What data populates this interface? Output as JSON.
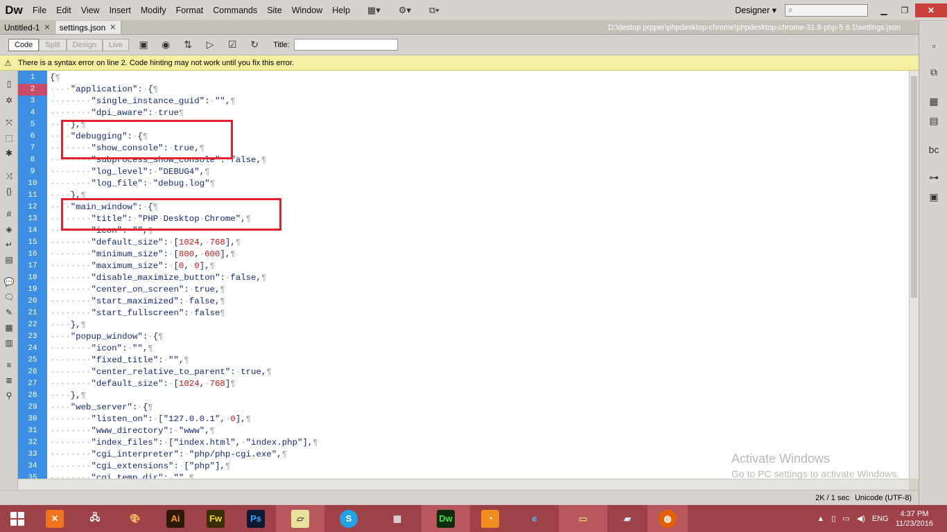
{
  "app": {
    "logo": "Dw",
    "menus": [
      "File",
      "Edit",
      "View",
      "Insert",
      "Modify",
      "Format",
      "Commands",
      "Site",
      "Window",
      "Help"
    ],
    "workspace": "Designer",
    "workspace_chevron": "▾"
  },
  "tabs": [
    {
      "label": "Untitled-1",
      "active": false
    },
    {
      "label": "settings.json",
      "active": true
    }
  ],
  "filepath": "D:\\destop prpper\\phpdesktop-chrome\\phpdesktop-chrome-31.8-php-5.6.1\\settings.json",
  "toolbar": {
    "views": [
      "Code",
      "Split",
      "Design",
      "Live"
    ],
    "title_label": "Title:",
    "title_value": ""
  },
  "warning": "There is a syntax error on line 2.  Code hinting may not work until you fix this error.",
  "editor": {
    "error_line": 2,
    "lines": [
      "{¶",
      "····\"application\":·{¶",
      "········\"single_instance_guid\":·\"\",¶",
      "········\"dpi_aware\":·true¶",
      "····},¶",
      "····\"debugging\":·{¶",
      "········\"show_console\":·true,¶",
      "········\"subprocess_show_console\":·false,¶",
      "········\"log_level\":·\"DEBUG4\",¶",
      "········\"log_file\":·\"debug.log\"¶",
      "····},¶",
      "····\"main_window\":·{¶",
      "········\"title\":·\"PHP·Desktop·Chrome\",¶",
      "········\"icon\":·\"\",¶",
      "········\"default_size\":·[1024,·768],¶",
      "········\"minimum_size\":·[800,·600],¶",
      "········\"maximum_size\":·[0,·0],¶",
      "········\"disable_maximize_button\":·false,¶",
      "········\"center_on_screen\":·true,¶",
      "········\"start_maximized\":·false,¶",
      "········\"start_fullscreen\":·false¶",
      "····},¶",
      "····\"popup_window\":·{¶",
      "········\"icon\":·\"\",¶",
      "········\"fixed_title\":·\"\",¶",
      "········\"center_relative_to_parent\":·true,¶",
      "········\"default_size\":·[1024,·768]¶",
      "····},¶",
      "····\"web_server\":·{¶",
      "········\"listen_on\":·[\"127.0.0.1\",·0],¶",
      "········\"www_directory\":·\"www\",¶",
      "········\"index_files\":·[\"index.html\",·\"index.php\"],¶",
      "········\"cgi_interpreter\":·\"php/php-cgi.exe\",¶",
      "········\"cgi_extensions\":·[\"php\"],¶",
      "········\"cgi_temp_dir\":·\"\",¶"
    ]
  },
  "status": {
    "size_time": "2K / 1 sec",
    "encoding": "Unicode (UTF-8)"
  },
  "watermark": {
    "title": "Activate Windows",
    "subtitle": "Go to PC settings to activate Windows."
  },
  "taskbar": {
    "apps": [
      "XAMPP",
      "Network",
      "Paint",
      "Ai",
      "Fw",
      "Ps",
      "Sticky",
      "Skype",
      "Firewall",
      "Dw",
      "UC",
      "IE",
      "Explorer",
      "Notes",
      "Firefox"
    ],
    "language": "ENG",
    "time": "4:37 PM",
    "date": "11/23/2016"
  }
}
